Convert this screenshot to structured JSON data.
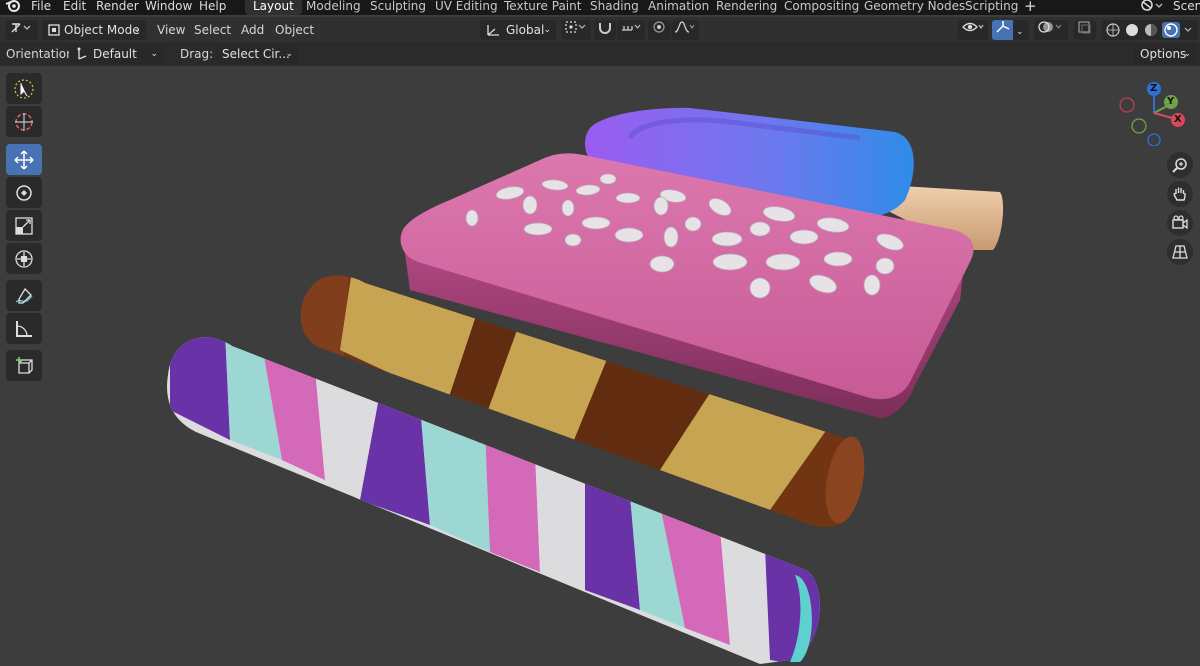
{
  "menu": {
    "items": [
      "File",
      "Edit",
      "Render",
      "Window",
      "Help"
    ]
  },
  "workspaces": {
    "tabs": [
      "Layout",
      "Modeling",
      "Sculpting",
      "UV Editing",
      "Texture Paint",
      "Shading",
      "Animation",
      "Rendering",
      "Compositing",
      "Geometry Nodes",
      "Scripting"
    ],
    "active": "Layout",
    "add_label": "+",
    "scene_label": "Scen"
  },
  "header": {
    "mode": "Object Mode",
    "menus": [
      "View",
      "Select",
      "Add",
      "Object"
    ],
    "transform_orientation": "Global"
  },
  "tool_settings": {
    "orientation_label": "Orientation:",
    "orientation_value": "Default",
    "drag_label": "Drag:",
    "drag_value": "Select Cir...",
    "options_label": "Options"
  },
  "gizmo": {
    "z": "Z",
    "y": "Y",
    "x": "X"
  },
  "colors": {
    "background": "#3d3d3d",
    "accent": "#4772b3"
  }
}
